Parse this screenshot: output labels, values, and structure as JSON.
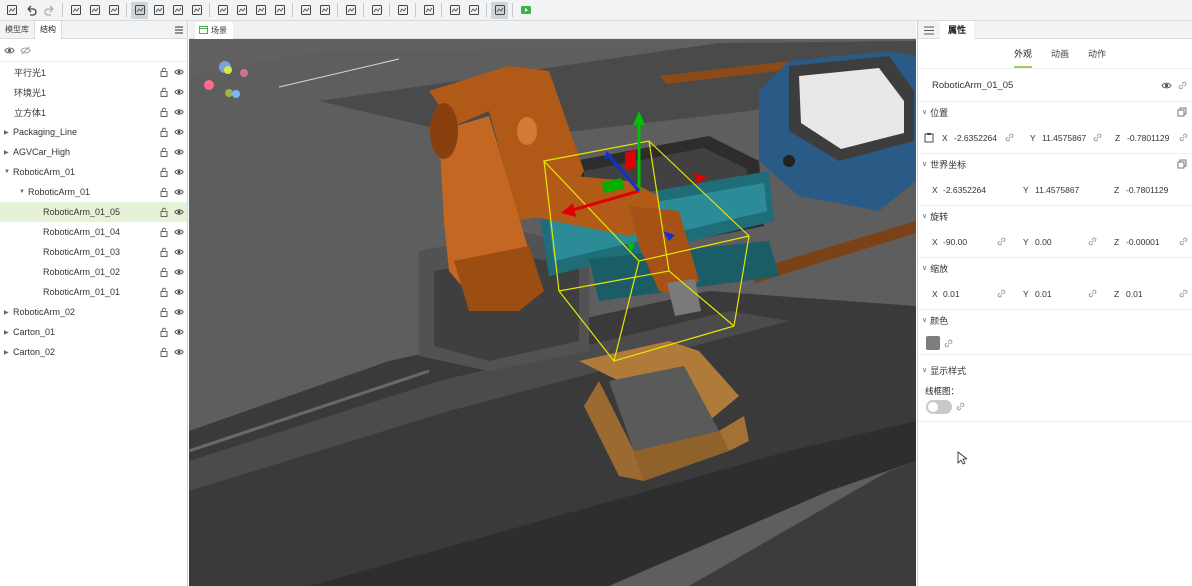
{
  "toolbar": {
    "icons": [
      "save-icon",
      "undo-icon",
      "redo-icon",
      "image-icon",
      "edit-image-icon",
      "transform-icon",
      "cube-front-icon",
      "cube-back-icon",
      "cube-side-icon",
      "cube-top-icon",
      "light-icon",
      "spot-icon",
      "point-light-icon",
      "cone-icon",
      "grid-icon",
      "duplicate-icon",
      "copy-icon",
      "paste-icon",
      "delete-icon",
      "target-icon",
      "crop-icon",
      "focus-icon",
      "link-icon",
      "play-icon"
    ]
  },
  "left_panel": {
    "tabs": [
      "模型库",
      "结构"
    ],
    "active_tab": "结构",
    "tree": [
      {
        "label": "平行光1",
        "indent": 0,
        "caret": false,
        "selected": false
      },
      {
        "label": "环境光1",
        "indent": 0,
        "caret": false,
        "selected": false
      },
      {
        "label": "立方体1",
        "indent": 0,
        "caret": false,
        "selected": false
      },
      {
        "label": "Packaging_Line",
        "indent": 0,
        "caret": "closed",
        "selected": false
      },
      {
        "label": "AGVCar_High",
        "indent": 0,
        "caret": "closed",
        "selected": false
      },
      {
        "label": "RoboticArm_01",
        "indent": 0,
        "caret": "open",
        "selected": false
      },
      {
        "label": "RoboticArm_01",
        "indent": 1,
        "caret": "open",
        "selected": false
      },
      {
        "label": "RoboticArm_01_05",
        "indent": 2,
        "caret": false,
        "selected": true
      },
      {
        "label": "RoboticArm_01_04",
        "indent": 2,
        "caret": false,
        "selected": false
      },
      {
        "label": "RoboticArm_01_03",
        "indent": 2,
        "caret": false,
        "selected": false
      },
      {
        "label": "RoboticArm_01_02",
        "indent": 2,
        "caret": false,
        "selected": false
      },
      {
        "label": "RoboticArm_01_01",
        "indent": 2,
        "caret": false,
        "selected": false
      },
      {
        "label": "RoboticArm_02",
        "indent": 0,
        "caret": "closed",
        "selected": false
      },
      {
        "label": "Carton_01",
        "indent": 0,
        "caret": "closed",
        "selected": false
      },
      {
        "label": "Carton_02",
        "indent": 0,
        "caret": "closed",
        "selected": false
      }
    ]
  },
  "viewport": {
    "tab_label": "场景"
  },
  "right_panel": {
    "tab": "属性",
    "subtabs": [
      "外观",
      "动画",
      "动作"
    ],
    "active_subtab": "外观",
    "object_name": "RoboticArm_01_05",
    "position": {
      "title": "位置",
      "x": "-2.6352264",
      "y": "11.4575867",
      "z": "-0.7801129"
    },
    "world": {
      "title": "世界坐标",
      "x": "-2.6352264",
      "y": "11.4575867",
      "z": "-0.7801129"
    },
    "rotation": {
      "title": "旋转",
      "x": "-90.00",
      "y": "0.00",
      "z": "-0.00001"
    },
    "scale": {
      "title": "缩放",
      "x": "0.01",
      "y": "0.01",
      "z": "0.01"
    },
    "color": {
      "title": "颜色",
      "value": "#7d7d7d"
    },
    "display": {
      "title": "显示样式",
      "wireframe_label": "线框图：",
      "wireframe_on": false
    },
    "axis_labels": {
      "x": "X",
      "y": "Y",
      "z": "Z"
    }
  },
  "colors": {
    "accent": "#9bcf5a",
    "selection": "#e6f2d7"
  }
}
